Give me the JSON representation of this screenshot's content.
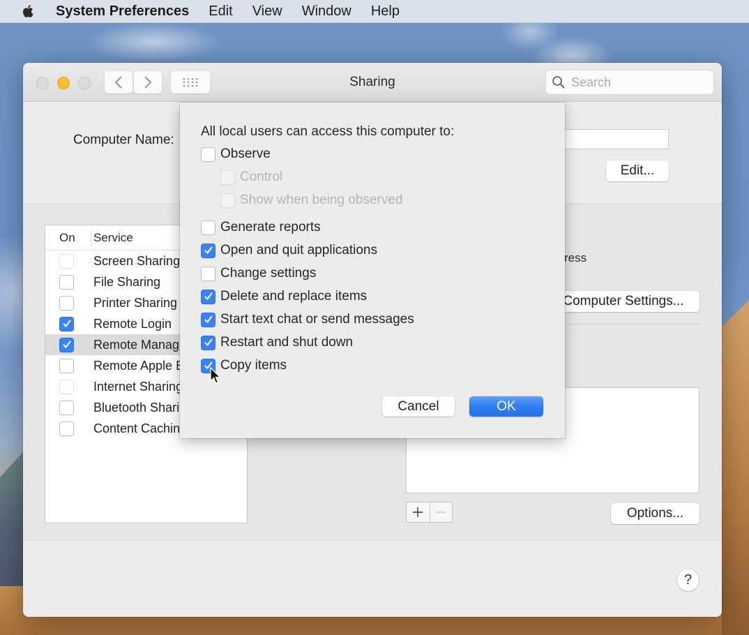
{
  "menubar": {
    "app_name": "System Preferences",
    "items": [
      "Edit",
      "View",
      "Window",
      "Help"
    ]
  },
  "window": {
    "title": "Sharing",
    "search": {
      "placeholder": "Search",
      "value": ""
    }
  },
  "computer_name": {
    "label": "Computer Name:",
    "value": "",
    "edit_label": "Edit..."
  },
  "services": {
    "header_on": "On",
    "header_service": "Service",
    "rows": [
      {
        "name": "Screen Sharing",
        "on": false,
        "selected": false
      },
      {
        "name": "File Sharing",
        "on": false,
        "selected": false
      },
      {
        "name": "Printer Sharing",
        "on": false,
        "selected": false
      },
      {
        "name": "Remote Login",
        "on": true,
        "selected": false
      },
      {
        "name": "Remote Management",
        "on": true,
        "selected": true
      },
      {
        "name": "Remote Apple Events",
        "on": false,
        "selected": false
      },
      {
        "name": "Internet Sharing",
        "on": false,
        "selected": false
      },
      {
        "name": "Bluetooth Sharing",
        "on": false,
        "selected": false
      },
      {
        "name": "Content Caching",
        "on": false,
        "selected": false
      }
    ]
  },
  "detail": {
    "address_text": "ress",
    "computer_settings_label": "Computer Settings...",
    "options_label": "Options...",
    "add_label": "+",
    "remove_label": "−",
    "help_label": "?"
  },
  "sheet": {
    "heading": "All local users can access this computer to:",
    "options": [
      {
        "label": "Observe",
        "checked": false,
        "enabled": true,
        "indent": false
      },
      {
        "label": "Control",
        "checked": false,
        "enabled": false,
        "indent": true
      },
      {
        "label": "Show when being observed",
        "checked": false,
        "enabled": false,
        "indent": true
      },
      {
        "label": "Generate reports",
        "checked": false,
        "enabled": true,
        "indent": false
      },
      {
        "label": "Open and quit applications",
        "checked": true,
        "enabled": true,
        "indent": false
      },
      {
        "label": "Change settings",
        "checked": false,
        "enabled": true,
        "indent": false
      },
      {
        "label": "Delete and replace items",
        "checked": true,
        "enabled": true,
        "indent": false
      },
      {
        "label": "Start text chat or send messages",
        "checked": true,
        "enabled": true,
        "indent": false
      },
      {
        "label": "Restart and shut down",
        "checked": true,
        "enabled": true,
        "indent": false
      },
      {
        "label": "Copy items",
        "checked": true,
        "enabled": true,
        "indent": false
      }
    ],
    "cancel_label": "Cancel",
    "ok_label": "OK"
  },
  "colors": {
    "accent": "#3b82f0",
    "minimize": "#fdbb2f"
  }
}
